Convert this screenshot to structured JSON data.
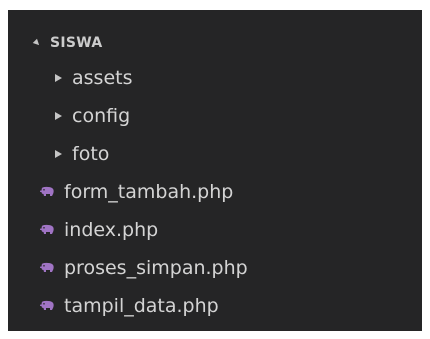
{
  "explorer": {
    "folder_title": "SISWA",
    "folders": [
      {
        "label": "assets"
      },
      {
        "label": "config"
      },
      {
        "label": "foto"
      }
    ],
    "files": [
      {
        "label": "form_tambah.php",
        "icon": "php-elephant-icon"
      },
      {
        "label": "index.php",
        "icon": "php-elephant-icon"
      },
      {
        "label": "proses_simpan.php",
        "icon": "php-elephant-icon"
      },
      {
        "label": "tampil_data.php",
        "icon": "php-elephant-icon"
      }
    ]
  },
  "colors": {
    "panel_background": "#252526",
    "text": "#cccccc",
    "php_icon": "#a074c4",
    "chevron": "#c5c5c5"
  }
}
